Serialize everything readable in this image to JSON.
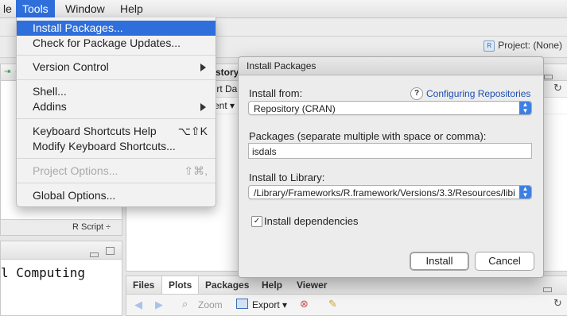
{
  "menubar": {
    "items": [
      {
        "label": "le"
      },
      {
        "label": "Tools"
      },
      {
        "label": "Window"
      },
      {
        "label": "Help"
      }
    ]
  },
  "header": {
    "project_label": "Project: (None)",
    "project_icon": "R"
  },
  "bg": {
    "fragment_story": "story",
    "fragment_port": "port Da",
    "fragment_ment": "ment ▾",
    "rscript_label": "R Script ÷",
    "console_text": "l Computing",
    "files_tabs": [
      "Files",
      "Plots",
      "Packages",
      "Help",
      "Viewer"
    ],
    "files_toolbar": {
      "zoom": "Zoom",
      "export": "Export ▾"
    }
  },
  "tools_menu": {
    "items": [
      {
        "label": "Install Packages...",
        "shortcut": ""
      },
      {
        "label": "Check for Package Updates...",
        "shortcut": ""
      },
      {
        "label": "Version Control",
        "shortcut": ""
      },
      {
        "label": "Shell...",
        "shortcut": ""
      },
      {
        "label": "Addins",
        "shortcut": ""
      },
      {
        "label": "Keyboard Shortcuts Help",
        "shortcut": "⌥⇧K"
      },
      {
        "label": "Modify Keyboard Shortcuts...",
        "shortcut": ""
      },
      {
        "label": "Project Options...",
        "shortcut": "⇧⌘,"
      },
      {
        "label": "Global Options...",
        "shortcut": ""
      }
    ]
  },
  "dialog": {
    "title": "Install Packages",
    "install_from_label": "Install from:",
    "help_icon": "?",
    "config_link": "Configuring Repositories",
    "install_from_value": "Repository (CRAN)",
    "packages_label": "Packages (separate multiple with space or comma):",
    "packages_value": "isdals",
    "library_label": "Install to Library:",
    "library_value": "/Library/Frameworks/R.framework/Versions/3.3/Resources/libi",
    "deps_label": "Install dependencies",
    "deps_checked": "✓",
    "install_button": "Install",
    "cancel_button": "Cancel"
  }
}
